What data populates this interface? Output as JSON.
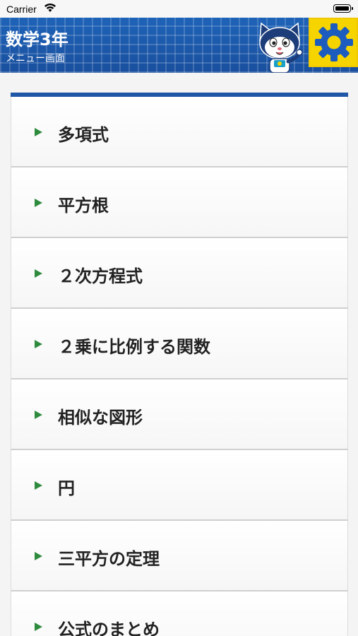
{
  "status": {
    "carrier": "Carrier"
  },
  "header": {
    "title": "数学3年",
    "subtitle": "メニュー画面"
  },
  "menu": {
    "items": [
      {
        "label": "多項式"
      },
      {
        "label": "平方根"
      },
      {
        "label": "２次方程式"
      },
      {
        "label": "２乗に比例する関数"
      },
      {
        "label": "相似な図形"
      },
      {
        "label": "円"
      },
      {
        "label": "三平方の定理"
      },
      {
        "label": "公式のまとめ"
      }
    ]
  },
  "colors": {
    "header": "#1f56a6",
    "arrow": "#2e8b3e",
    "settings_bg": "#f6d400",
    "gear": "#1d5cbf"
  },
  "icons": {
    "settings": "gear-icon",
    "mascot": "mascot-cat-icon",
    "wifi": "wifi-icon",
    "battery": "battery-icon"
  }
}
